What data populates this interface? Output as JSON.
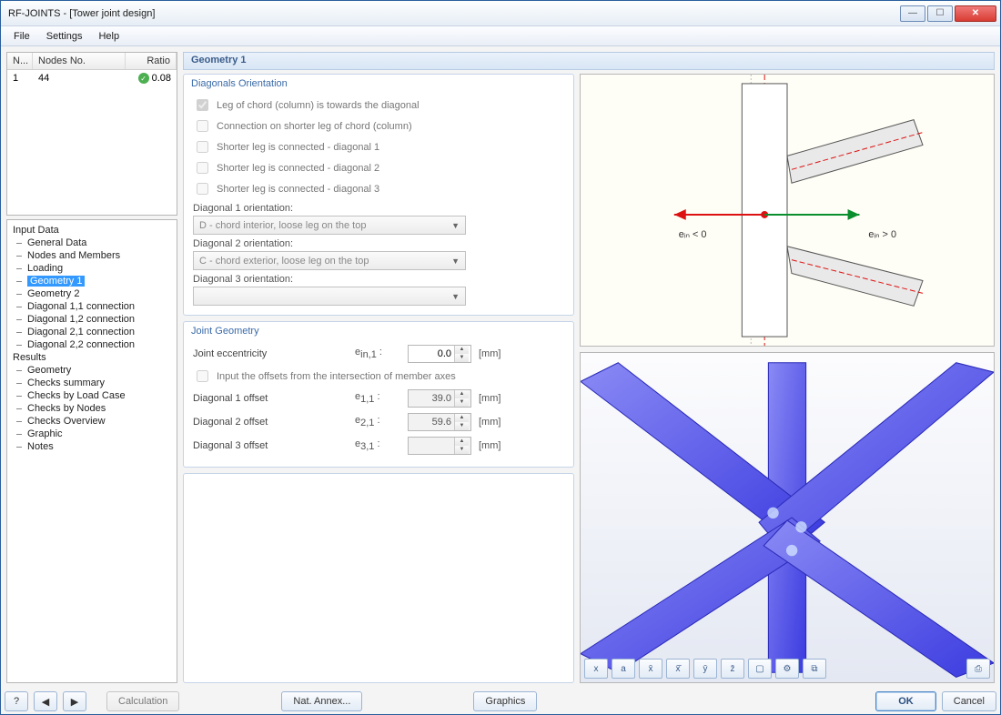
{
  "window": {
    "title": "RF-JOINTS - [Tower joint design]"
  },
  "menu": {
    "file": "File",
    "settings": "Settings",
    "help": "Help"
  },
  "grid": {
    "col1": "N...",
    "col2": "Nodes No.",
    "col3": "Ratio",
    "row1": {
      "n": "1",
      "nodes": "44",
      "ratio": "0.08"
    }
  },
  "nav": {
    "input": "Input Data",
    "general": "General Data",
    "nodes": "Nodes and Members",
    "loading": "Loading",
    "geom1": "Geometry 1",
    "geom2": "Geometry 2",
    "d11": "Diagonal 1,1 connection",
    "d12": "Diagonal 1,2 connection",
    "d21": "Diagonal 2,1 connection",
    "d22": "Diagonal 2,2 connection",
    "results": "Results",
    "rgeom": "Geometry",
    "rchk": "Checks summary",
    "rlc": "Checks by Load Case",
    "rnodes": "Checks by Nodes",
    "rover": "Checks Overview",
    "rgraphic": "Graphic",
    "rnotes": "Notes"
  },
  "panel": {
    "title": "Geometry 1",
    "diag_orient_legend": "Diagonals Orientation",
    "chk_leg": "Leg of chord (column) is towards the diagonal",
    "chk_short": "Connection on shorter leg of chord (column)",
    "chk_d1": "Shorter leg is connected - diagonal 1",
    "chk_d2": "Shorter leg is connected - diagonal 2",
    "chk_d3": "Shorter leg is connected - diagonal 3",
    "d1_label": "Diagonal 1 orientation:",
    "d1_value": "D - chord interior, loose leg on the top",
    "d2_label": "Diagonal 2 orientation:",
    "d2_value": "C - chord exterior, loose leg on the top",
    "d3_label": "Diagonal 3 orientation:",
    "d3_value": "",
    "jg_legend": "Joint Geometry",
    "ecc_label": "Joint eccentricity",
    "ecc_sym": "eₙₑ,1 :",
    "ecc_sym_plain": "e_in,1 :",
    "ecc_val": "0.0",
    "mm": "[mm]",
    "input_offsets": "Input the offsets from the intersection of member axes",
    "off1_label": "Diagonal 1 offset",
    "off1_sym": "e₁,₁ :",
    "off1_val": "39.0",
    "off2_label": "Diagonal 2 offset",
    "off2_sym": "e₂,₁ :",
    "off2_val": "59.6",
    "off3_label": "Diagonal 3 offset",
    "off3_sym": "e₃,₁ :",
    "off3_val": "",
    "ein_lt": "eᵢₙ < 0",
    "ein_gt": "eᵢₙ > 0"
  },
  "footer": {
    "calc": "Calculation",
    "annex": "Nat. Annex...",
    "graphics": "Graphics",
    "ok": "OK",
    "cancel": "Cancel"
  },
  "vp_icons": [
    "x",
    "a",
    "x̅",
    "x̅̅",
    "y̅",
    "z̅",
    "☐",
    "⚙",
    "⧉",
    "⤓"
  ]
}
